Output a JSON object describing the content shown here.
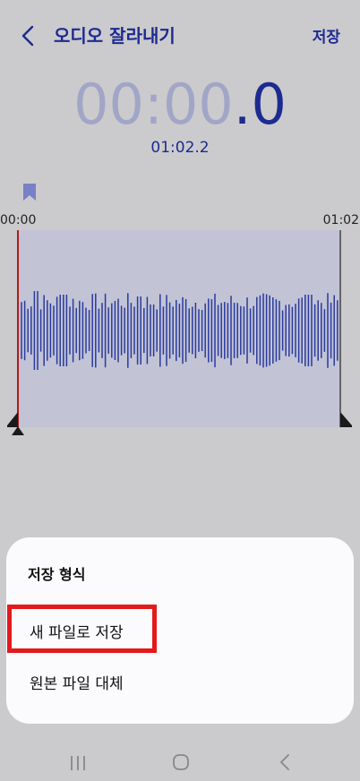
{
  "header": {
    "title": "오디오 잘라내기",
    "save_label": "저장"
  },
  "timer": {
    "main": "00:00",
    "fraction": ".0"
  },
  "duration": "01:02.2",
  "timeline": {
    "start": "00:00",
    "end": "01:02"
  },
  "sheet": {
    "title": "저장 형식",
    "options": [
      "새 파일로 저장",
      "원본 파일 대체"
    ]
  },
  "colors": {
    "accent": "#1d2a8f",
    "highlight_box": "#e3191c",
    "playhead": "#b31a1a"
  },
  "icons": [
    "back-arrow-icon",
    "bookmark-icon",
    "recents-icon",
    "home-icon",
    "back-nav-icon"
  ]
}
